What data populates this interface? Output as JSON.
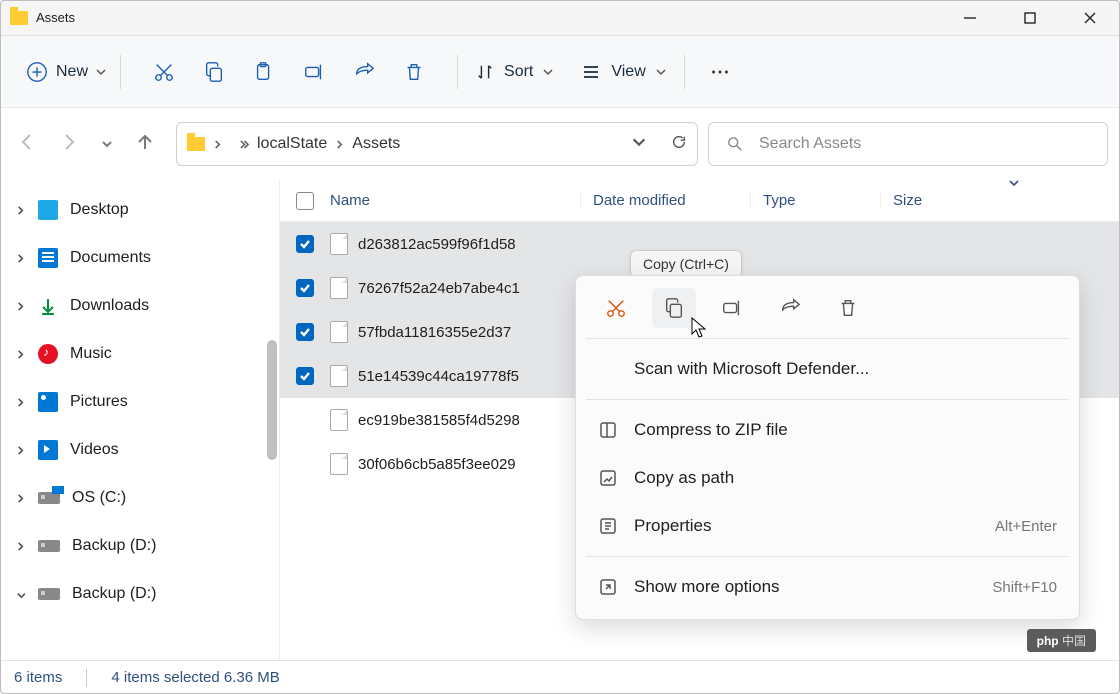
{
  "window": {
    "title": "Assets"
  },
  "toolbar": {
    "new": "New",
    "cut": "Cut",
    "copy": "Copy",
    "paste": "Paste",
    "rename": "Rename",
    "share": "Share",
    "delete": "Delete",
    "sort": "Sort",
    "view": "View",
    "more": "See more"
  },
  "path": {
    "segments": [
      "localState",
      "Assets"
    ],
    "refresh": "Refresh"
  },
  "search": {
    "placeholder": "Search Assets"
  },
  "sidebar": {
    "items": [
      {
        "label": "Desktop",
        "icon": "sq"
      },
      {
        "label": "Documents",
        "icon": "doc"
      },
      {
        "label": "Downloads",
        "icon": "dl"
      },
      {
        "label": "Music",
        "icon": "music"
      },
      {
        "label": "Pictures",
        "icon": "pic"
      },
      {
        "label": "Videos",
        "icon": "vid"
      },
      {
        "label": "OS (C:)",
        "icon": "drive os"
      },
      {
        "label": "Backup (D:)",
        "icon": "drive"
      },
      {
        "label": "Backup (D:)",
        "icon": "drive",
        "expanded": true
      }
    ]
  },
  "columns": {
    "name": "Name",
    "date": "Date modified",
    "type": "Type",
    "size": "Size"
  },
  "files": [
    {
      "name": "d263812ac599f96f1d58",
      "selected": true
    },
    {
      "name": "76267f52a24eb7abe4c1",
      "selected": true
    },
    {
      "name": "57fbda11816355e2d37",
      "selected": true
    },
    {
      "name": "51e14539c44ca19778f5",
      "selected": true
    },
    {
      "name": "ec919be381585f4d5298",
      "selected": false
    },
    {
      "name": "30f06b6cb5a85f3ee029",
      "selected": false
    }
  ],
  "tooltip": "Copy (Ctrl+C)",
  "context_menu": {
    "scan": "Scan with Microsoft Defender...",
    "zip": "Compress to ZIP file",
    "copypath": "Copy as path",
    "properties": "Properties",
    "properties_sc": "Alt+Enter",
    "showmore": "Show more options",
    "showmore_sc": "Shift+F10"
  },
  "status": {
    "count": "6 items",
    "selection": "4 items selected  6.36 MB"
  },
  "badge_prefix": "php",
  "badge_suffix": "中国"
}
